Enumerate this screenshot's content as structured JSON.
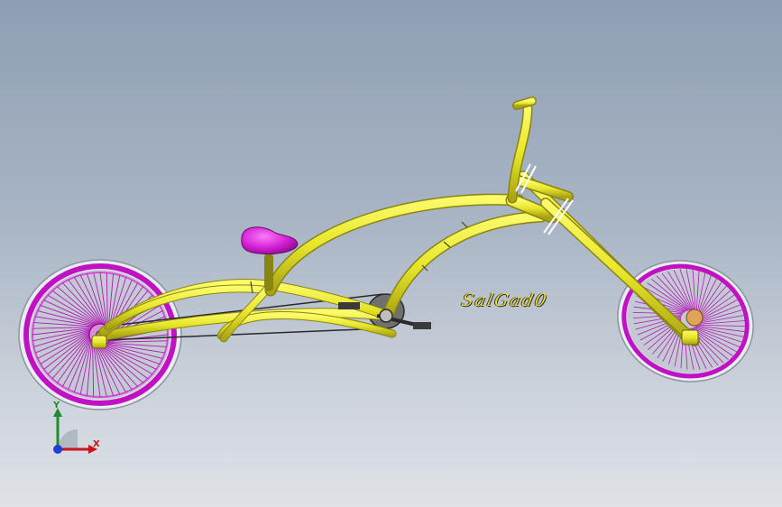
{
  "viewport": {
    "signature": "SalGad0",
    "triad": {
      "x_label": "X",
      "y_label": "Y"
    }
  },
  "colors": {
    "frame": "#ecea2a",
    "rims": "#c012c4",
    "tires": "#e9ecf0",
    "seat": "#d61fd6",
    "axis_x": "#c4161c",
    "axis_y": "#1e8c2a",
    "axis_z": "#1f3fd6"
  },
  "icons": [
    "coordinate-triad-icon"
  ]
}
